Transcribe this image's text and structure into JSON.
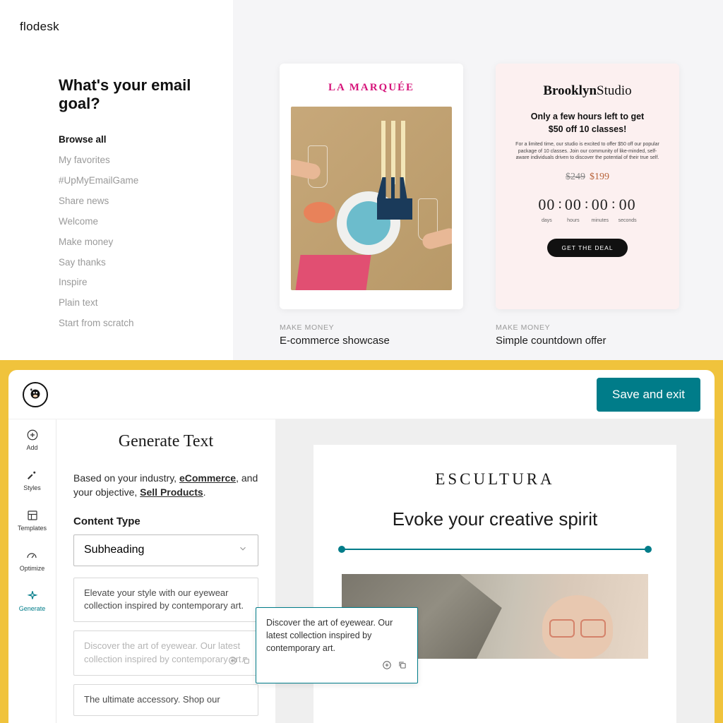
{
  "flodesk": {
    "logo": "flodesk",
    "heading": "What's your email goal?",
    "nav": [
      {
        "label": "Browse all",
        "active": true
      },
      {
        "label": "My favorites"
      },
      {
        "label": "#UpMyEmailGame"
      },
      {
        "label": "Share news"
      },
      {
        "label": "Welcome"
      },
      {
        "label": "Make money"
      },
      {
        "label": "Say thanks"
      },
      {
        "label": "Inspire"
      },
      {
        "label": "Plain text"
      },
      {
        "label": "Start from scratch"
      }
    ],
    "templates": [
      {
        "category": "MAKE MONEY",
        "title": "E-commerce showcase",
        "brand": "LA MARQUÉE"
      },
      {
        "category": "MAKE MONEY",
        "title": "Simple countdown offer",
        "brand_bold": "Brooklyn",
        "brand_light": "Studio",
        "headline_l1": "Only a few hours left to get",
        "headline_l2": "$50 off 10 classes!",
        "sub": "For a limited time, our studio is excited to offer $50 off our popular package of 10 classes. Join our community of like-minded, self-aware individuals driven to discover the potential of their true self.",
        "price_old": "$249",
        "price_new": "$199",
        "timer": [
          {
            "val": "00",
            "label": "days"
          },
          {
            "val": "00",
            "label": "hours"
          },
          {
            "val": "00",
            "label": "minutes"
          },
          {
            "val": "00",
            "label": "seconds"
          }
        ],
        "cta": "GET THE DEAL"
      }
    ]
  },
  "mailchimp": {
    "save_btn": "Save and exit",
    "rail": [
      {
        "label": "Add"
      },
      {
        "label": "Styles"
      },
      {
        "label": "Templates"
      },
      {
        "label": "Optimize"
      },
      {
        "label": "Generate",
        "active": true
      }
    ],
    "panel": {
      "title": "Generate Text",
      "desc_pre": "Based on your industry, ",
      "desc_industry": "eCommerce",
      "desc_mid": ", and your objective, ",
      "desc_objective": "Sell Products",
      "desc_end": ".",
      "content_type_label": "Content Type",
      "select_value": "Subheading",
      "suggestions": [
        "Elevate your style with our eyewear collection inspired by contemporary art.",
        "Discover the art of eyewear. Our latest collection inspired by contemporary art.",
        "The ultimate accessory. Shop our"
      ],
      "tooltip": "Discover the art of eyewear. Our latest collection inspired by contemporary art."
    },
    "email": {
      "brand": "ESCULTURA",
      "heading": "Evoke your creative spirit"
    }
  }
}
